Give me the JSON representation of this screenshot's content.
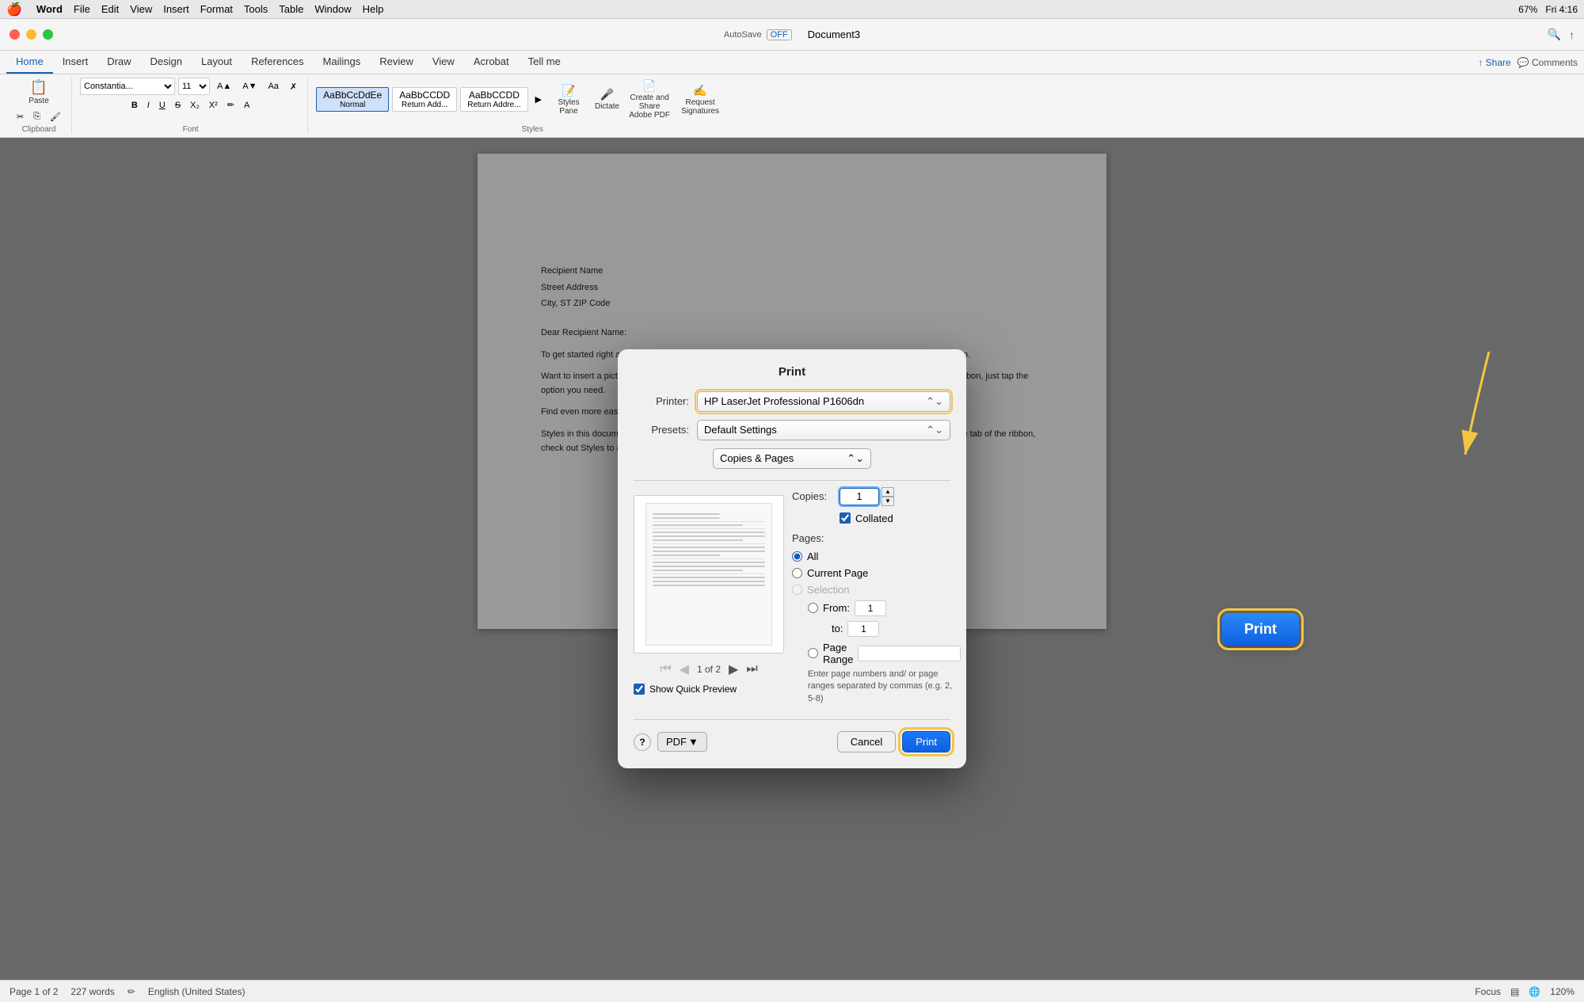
{
  "menubar": {
    "apple": "🍎",
    "items": [
      "Word",
      "File",
      "Edit",
      "View",
      "Insert",
      "Format",
      "Tools",
      "Table",
      "Window",
      "Help"
    ],
    "right": {
      "time": "Fri 4:16",
      "battery": "67%"
    }
  },
  "titlebar": {
    "title": "Document3",
    "autosave_label": "AutoSave",
    "autosave_state": "OFF"
  },
  "ribbon": {
    "tabs": [
      "Home",
      "Insert",
      "Draw",
      "Design",
      "Layout",
      "References",
      "Mailings",
      "Review",
      "View",
      "Acrobat",
      "Tell me"
    ],
    "active_tab": "Home",
    "font": "Constantia...",
    "font_size": "11",
    "styles": [
      "Normal",
      "Return Add...",
      "Return Addre...",
      "▶"
    ],
    "active_style": "Normal",
    "style_pane_label": "Styles Pane",
    "dictate_label": "Dictate",
    "create_share_label": "Create and Share Adobe PDF",
    "request_signatures_label": "Request Signatures"
  },
  "document": {
    "recipient_name": "Recipient Name",
    "street_address": "Street Address",
    "city_state_zip": "City, ST ZIP Code",
    "salutation": "Dear Recipient Name:",
    "paragraphs": [
      "To get started right away, just tap any placeholder text (such as this) and start typing to replace it with your own.",
      "Want to insert a picture from your files or add a shape, text box, or table? You got it! On the Insert tab of the ribbon, just tap the option you need.",
      "Find even more easy-to-use tools on the Insert tab, such as to add a hyperlink or insert a comment.",
      "Styles in this document have been customized to match the text formatting you see on this page. On the Home tab of the ribbon, check out Styles to apply the formatting you want with just a tap."
    ]
  },
  "statusbar": {
    "page_info": "Page 1 of 2",
    "word_count": "227 words",
    "language": "English (United States)",
    "focus_label": "Focus",
    "zoom": "120%"
  },
  "print_dialog": {
    "title": "Print",
    "printer_label": "Printer:",
    "printer_value": "HP LaserJet Professional P1606dn",
    "presets_label": "Presets:",
    "presets_value": "Default Settings",
    "section_label": "Copies & Pages",
    "copies_label": "Copies:",
    "copies_value": "1",
    "collated_label": "Collated",
    "collated_checked": true,
    "pages_label": "Pages:",
    "page_options": [
      "All",
      "Current Page",
      "Selection",
      "From:",
      "to:",
      "Page Range"
    ],
    "all_selected": true,
    "from_value": "1",
    "to_value": "1",
    "page_range_hint": "Enter page numbers and/\nor page ranges separated\nby commas (e.g. 2, 5-8)",
    "preview_page": "1 of 2",
    "show_quick_preview_label": "Show Quick Preview",
    "show_quick_preview": true,
    "help_label": "?",
    "pdf_label": "PDF",
    "cancel_label": "Cancel",
    "print_label": "Print",
    "floating_print_label": "Print"
  }
}
